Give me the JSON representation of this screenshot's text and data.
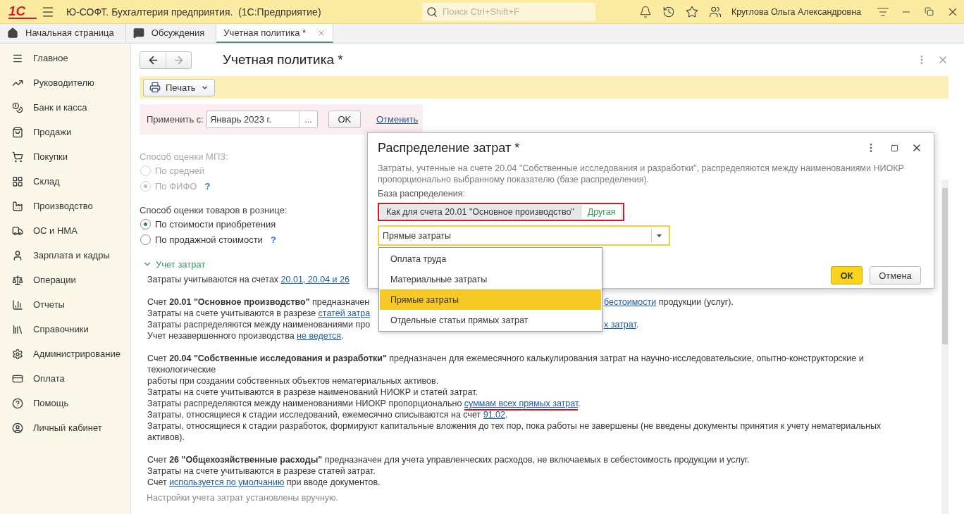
{
  "app": {
    "logo": "1С",
    "title": "Ю-СОФТ. Бухгалтерия предприятия.  (1С:Предприятие)",
    "search": {
      "placeholder": "Поиск Ctrl+Shift+F"
    },
    "user": "Круглова Ольга Александровна"
  },
  "tabs": [
    {
      "label": "Начальная страница",
      "selected": false,
      "closable": false
    },
    {
      "label": "Обсуждения",
      "selected": false,
      "closable": false
    },
    {
      "label": "Учетная политика *",
      "selected": true,
      "closable": true
    }
  ],
  "sidebar": {
    "items": [
      {
        "label": "Главное"
      },
      {
        "label": "Руководителю"
      },
      {
        "label": "Банк и касса"
      },
      {
        "label": "Продажи"
      },
      {
        "label": "Покупки"
      },
      {
        "label": "Склад"
      },
      {
        "label": "Производство"
      },
      {
        "label": "ОС и НМА"
      },
      {
        "label": "Зарплата и кадры"
      },
      {
        "label": "Операции"
      },
      {
        "label": "Отчеты"
      },
      {
        "label": "Справочники"
      },
      {
        "label": "Администрирование"
      },
      {
        "label": "Оплата"
      },
      {
        "label": "Помощь"
      },
      {
        "label": "Личный кабинет"
      }
    ]
  },
  "form": {
    "title": "Учетная политика *",
    "nav": {
      "back_enabled": true,
      "forward_enabled": false
    },
    "print_button": "Печать",
    "apply": {
      "label": "Применить с:",
      "value": "Январь 2023 г.",
      "picker": "...",
      "ok": "OK",
      "cancel": "Отменить"
    },
    "groups": [
      {
        "label": "Способ оценки МПЗ:",
        "disabled": true,
        "options": [
          {
            "label": "По средней",
            "selected": false
          },
          {
            "label": "По ФИФО",
            "selected": true,
            "help": "?"
          }
        ]
      },
      {
        "label": "Способ оценки товаров в рознице:",
        "disabled": false,
        "options": [
          {
            "label": "По стоимости приобретения",
            "selected": true
          },
          {
            "label": "По продажной стоимости",
            "selected": false,
            "help": "?"
          }
        ]
      }
    ],
    "section": {
      "title": "Учет затрат",
      "expanded": true,
      "paragraphs": [
        {
          "lines": [
            {
              "segments": [
                {
                  "kind": "text",
                  "text": "Затраты учитываются на счетах "
                },
                {
                  "kind": "link",
                  "text": "20.01, 20.04 и 26",
                  "marked": false
                }
              ]
            }
          ]
        },
        {
          "lines": [
            {
              "segments": [
                {
                  "kind": "text",
                  "text": "Счет **20.01 \"Основное производство\"** предназначен"
                }
              ],
              "right": [
                {
                  "kind": "link",
                  "text": "бестоимости",
                  "marked": false
                },
                {
                  "kind": "text",
                  "text": " продукции (услуг)."
                }
              ]
            },
            {
              "segments": [
                {
                  "kind": "text",
                  "text": "Затраты на счете учитываются в разрезе "
                },
                {
                  "kind": "link",
                  "text": "статей затра",
                  "marked": false
                }
              ]
            },
            {
              "segments": [
                {
                  "kind": "text",
                  "text": "Затраты распределяются между наименованиями про"
                }
              ],
              "right": [
                {
                  "kind": "link",
                  "text": "х затрат",
                  "marked": false
                },
                {
                  "kind": "text",
                  "text": "."
                }
              ]
            },
            {
              "segments": [
                {
                  "kind": "text",
                  "text": "Учет незавершенного производства "
                },
                {
                  "kind": "link",
                  "text": "не ведется",
                  "marked": false
                },
                {
                  "kind": "text",
                  "text": "."
                }
              ]
            }
          ]
        },
        {
          "lines": [
            {
              "segments": [
                {
                  "kind": "text",
                  "text": "Счет **20.04 \"Собственные исследования и разработки\"** предназначен для ежемесячного калькулирования затрат на научно-исследовательские, опытно-конструкторские и"
                }
              ]
            },
            {
              "segments": [
                {
                  "kind": "text",
                  "text": "технологические"
                }
              ]
            },
            {
              "segments": [
                {
                  "kind": "text",
                  "text": "работы при создании собственных объектов нематериальных активов."
                }
              ]
            },
            {
              "segments": [
                {
                  "kind": "text",
                  "text": "Затраты на счете учитываются в разрезе наименований НИОКР и статей затрат."
                }
              ]
            },
            {
              "segments": [
                {
                  "kind": "text",
                  "text": "Затраты распределяются между наименованиями НИОКР пропорционально "
                },
                {
                  "kind": "link",
                  "text": "суммам всех прямых затрат",
                  "marked": true
                },
                {
                  "kind": "text",
                  "text": "."
                }
              ]
            },
            {
              "segments": [
                {
                  "kind": "text",
                  "text": "Затраты, относящиеся к стадии исследований, ежемесячно списываются на счет "
                },
                {
                  "kind": "link",
                  "text": "91.02",
                  "marked": false
                },
                {
                  "kind": "text",
                  "text": "."
                }
              ]
            },
            {
              "segments": [
                {
                  "kind": "text",
                  "text": "Затраты, относящиеся к стадии разработок, формируют капитальные вложения до тех пор, пока работы не завершены (не введены документы принятия к учету нематериальных"
                }
              ]
            },
            {
              "segments": [
                {
                  "kind": "text",
                  "text": "активов)."
                }
              ]
            }
          ]
        },
        {
          "lines": [
            {
              "segments": [
                {
                  "kind": "text",
                  "text": "Счет **26 \"Общехозяйственные расходы\"** предназначен для учета управленческих расходов, не включаемых в себестоимость продукции и услуг."
                }
              ]
            },
            {
              "segments": [
                {
                  "kind": "text",
                  "text": "Затраты на счете учитываются в разрезе статей затрат."
                }
              ]
            },
            {
              "segments": [
                {
                  "kind": "text",
                  "text": "Счет "
                },
                {
                  "kind": "link",
                  "text": "используется по умолчанию",
                  "marked": false
                },
                {
                  "kind": "text",
                  "text": " при вводе документов."
                }
              ]
            }
          ]
        }
      ],
      "footer": "Настройки учета затрат установлены вручную."
    }
  },
  "dialog": {
    "title": "Распределение затрат *",
    "description": [
      "Затраты, учтенные на счете 20.04 \"Собственные исследования и разработки\", распределяются между наименованиями НИОКР",
      "пропорционально выбранному показателю (базе распределения)."
    ],
    "base_label": "База распределения:",
    "base_highlighted": true,
    "base_options": [
      {
        "label": "Как для счета 20.01 \"Основное производство\"",
        "selected": false
      },
      {
        "label": "Другая",
        "selected": true
      }
    ],
    "combo": {
      "value": "Прямые затраты",
      "focused": true,
      "expanded": true
    },
    "dropdown": [
      {
        "label": "Оплата труда",
        "selected": false
      },
      {
        "label": "Материальные затраты",
        "selected": false
      },
      {
        "label": "Прямые затраты",
        "selected": true
      },
      {
        "label": "Отдельные статьи прямых затрат",
        "selected": false
      }
    ],
    "ok": "ОК",
    "cancel": "Отмена"
  }
}
